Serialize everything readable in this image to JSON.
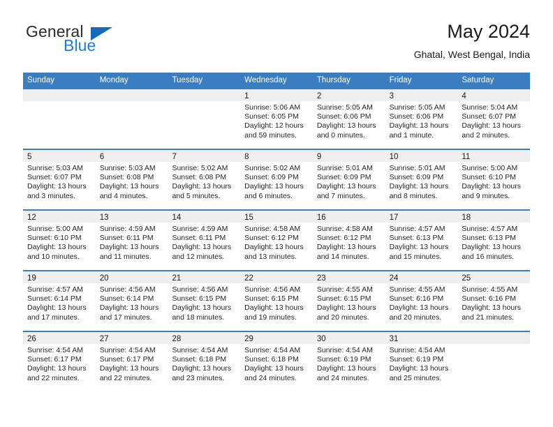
{
  "brand": {
    "name_part1": "General",
    "name_part2": "Blue"
  },
  "header": {
    "title": "May 2024",
    "location": "Ghatal, West Bengal, India"
  },
  "weekdays": [
    "Sunday",
    "Monday",
    "Tuesday",
    "Wednesday",
    "Thursday",
    "Friday",
    "Saturday"
  ],
  "colors": {
    "header_blue": "#3a7ec1",
    "logo_blue": "#1c7fd4",
    "day_band_gray": "#efefef"
  },
  "weeks": [
    [
      {
        "date": ""
      },
      {
        "date": ""
      },
      {
        "date": ""
      },
      {
        "date": "1",
        "sunrise": "Sunrise: 5:06 AM",
        "sunset": "Sunset: 6:05 PM",
        "daylight_line1": "Daylight: 12 hours",
        "daylight_line2": "and 59 minutes."
      },
      {
        "date": "2",
        "sunrise": "Sunrise: 5:05 AM",
        "sunset": "Sunset: 6:06 PM",
        "daylight_line1": "Daylight: 13 hours",
        "daylight_line2": "and 0 minutes."
      },
      {
        "date": "3",
        "sunrise": "Sunrise: 5:05 AM",
        "sunset": "Sunset: 6:06 PM",
        "daylight_line1": "Daylight: 13 hours",
        "daylight_line2": "and 1 minute."
      },
      {
        "date": "4",
        "sunrise": "Sunrise: 5:04 AM",
        "sunset": "Sunset: 6:07 PM",
        "daylight_line1": "Daylight: 13 hours",
        "daylight_line2": "and 2 minutes."
      }
    ],
    [
      {
        "date": "5",
        "sunrise": "Sunrise: 5:03 AM",
        "sunset": "Sunset: 6:07 PM",
        "daylight_line1": "Daylight: 13 hours",
        "daylight_line2": "and 3 minutes."
      },
      {
        "date": "6",
        "sunrise": "Sunrise: 5:03 AM",
        "sunset": "Sunset: 6:08 PM",
        "daylight_line1": "Daylight: 13 hours",
        "daylight_line2": "and 4 minutes."
      },
      {
        "date": "7",
        "sunrise": "Sunrise: 5:02 AM",
        "sunset": "Sunset: 6:08 PM",
        "daylight_line1": "Daylight: 13 hours",
        "daylight_line2": "and 5 minutes."
      },
      {
        "date": "8",
        "sunrise": "Sunrise: 5:02 AM",
        "sunset": "Sunset: 6:09 PM",
        "daylight_line1": "Daylight: 13 hours",
        "daylight_line2": "and 6 minutes."
      },
      {
        "date": "9",
        "sunrise": "Sunrise: 5:01 AM",
        "sunset": "Sunset: 6:09 PM",
        "daylight_line1": "Daylight: 13 hours",
        "daylight_line2": "and 7 minutes."
      },
      {
        "date": "10",
        "sunrise": "Sunrise: 5:01 AM",
        "sunset": "Sunset: 6:09 PM",
        "daylight_line1": "Daylight: 13 hours",
        "daylight_line2": "and 8 minutes."
      },
      {
        "date": "11",
        "sunrise": "Sunrise: 5:00 AM",
        "sunset": "Sunset: 6:10 PM",
        "daylight_line1": "Daylight: 13 hours",
        "daylight_line2": "and 9 minutes."
      }
    ],
    [
      {
        "date": "12",
        "sunrise": "Sunrise: 5:00 AM",
        "sunset": "Sunset: 6:10 PM",
        "daylight_line1": "Daylight: 13 hours",
        "daylight_line2": "and 10 minutes."
      },
      {
        "date": "13",
        "sunrise": "Sunrise: 4:59 AM",
        "sunset": "Sunset: 6:11 PM",
        "daylight_line1": "Daylight: 13 hours",
        "daylight_line2": "and 11 minutes."
      },
      {
        "date": "14",
        "sunrise": "Sunrise: 4:59 AM",
        "sunset": "Sunset: 6:11 PM",
        "daylight_line1": "Daylight: 13 hours",
        "daylight_line2": "and 12 minutes."
      },
      {
        "date": "15",
        "sunrise": "Sunrise: 4:58 AM",
        "sunset": "Sunset: 6:12 PM",
        "daylight_line1": "Daylight: 13 hours",
        "daylight_line2": "and 13 minutes."
      },
      {
        "date": "16",
        "sunrise": "Sunrise: 4:58 AM",
        "sunset": "Sunset: 6:12 PM",
        "daylight_line1": "Daylight: 13 hours",
        "daylight_line2": "and 14 minutes."
      },
      {
        "date": "17",
        "sunrise": "Sunrise: 4:57 AM",
        "sunset": "Sunset: 6:13 PM",
        "daylight_line1": "Daylight: 13 hours",
        "daylight_line2": "and 15 minutes."
      },
      {
        "date": "18",
        "sunrise": "Sunrise: 4:57 AM",
        "sunset": "Sunset: 6:13 PM",
        "daylight_line1": "Daylight: 13 hours",
        "daylight_line2": "and 16 minutes."
      }
    ],
    [
      {
        "date": "19",
        "sunrise": "Sunrise: 4:57 AM",
        "sunset": "Sunset: 6:14 PM",
        "daylight_line1": "Daylight: 13 hours",
        "daylight_line2": "and 17 minutes."
      },
      {
        "date": "20",
        "sunrise": "Sunrise: 4:56 AM",
        "sunset": "Sunset: 6:14 PM",
        "daylight_line1": "Daylight: 13 hours",
        "daylight_line2": "and 17 minutes."
      },
      {
        "date": "21",
        "sunrise": "Sunrise: 4:56 AM",
        "sunset": "Sunset: 6:15 PM",
        "daylight_line1": "Daylight: 13 hours",
        "daylight_line2": "and 18 minutes."
      },
      {
        "date": "22",
        "sunrise": "Sunrise: 4:56 AM",
        "sunset": "Sunset: 6:15 PM",
        "daylight_line1": "Daylight: 13 hours",
        "daylight_line2": "and 19 minutes."
      },
      {
        "date": "23",
        "sunrise": "Sunrise: 4:55 AM",
        "sunset": "Sunset: 6:15 PM",
        "daylight_line1": "Daylight: 13 hours",
        "daylight_line2": "and 20 minutes."
      },
      {
        "date": "24",
        "sunrise": "Sunrise: 4:55 AM",
        "sunset": "Sunset: 6:16 PM",
        "daylight_line1": "Daylight: 13 hours",
        "daylight_line2": "and 20 minutes."
      },
      {
        "date": "25",
        "sunrise": "Sunrise: 4:55 AM",
        "sunset": "Sunset: 6:16 PM",
        "daylight_line1": "Daylight: 13 hours",
        "daylight_line2": "and 21 minutes."
      }
    ],
    [
      {
        "date": "26",
        "sunrise": "Sunrise: 4:54 AM",
        "sunset": "Sunset: 6:17 PM",
        "daylight_line1": "Daylight: 13 hours",
        "daylight_line2": "and 22 minutes."
      },
      {
        "date": "27",
        "sunrise": "Sunrise: 4:54 AM",
        "sunset": "Sunset: 6:17 PM",
        "daylight_line1": "Daylight: 13 hours",
        "daylight_line2": "and 22 minutes."
      },
      {
        "date": "28",
        "sunrise": "Sunrise: 4:54 AM",
        "sunset": "Sunset: 6:18 PM",
        "daylight_line1": "Daylight: 13 hours",
        "daylight_line2": "and 23 minutes."
      },
      {
        "date": "29",
        "sunrise": "Sunrise: 4:54 AM",
        "sunset": "Sunset: 6:18 PM",
        "daylight_line1": "Daylight: 13 hours",
        "daylight_line2": "and 24 minutes."
      },
      {
        "date": "30",
        "sunrise": "Sunrise: 4:54 AM",
        "sunset": "Sunset: 6:19 PM",
        "daylight_line1": "Daylight: 13 hours",
        "daylight_line2": "and 24 minutes."
      },
      {
        "date": "31",
        "sunrise": "Sunrise: 4:54 AM",
        "sunset": "Sunset: 6:19 PM",
        "daylight_line1": "Daylight: 13 hours",
        "daylight_line2": "and 25 minutes."
      },
      {
        "date": ""
      }
    ]
  ]
}
